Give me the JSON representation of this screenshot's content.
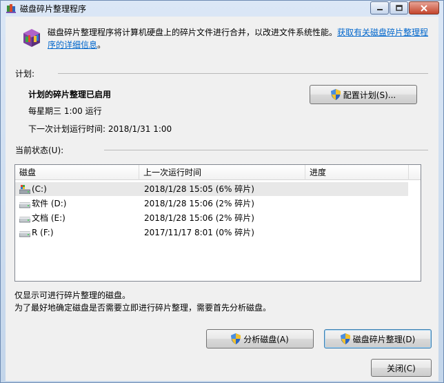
{
  "window": {
    "title": "磁盘碎片整理程序"
  },
  "intro": {
    "text": "磁盘碎片整理程序将计算机硬盘上的碎片文件进行合并，以改进文件系统性能。",
    "link": "获取有关磁盘碎片整理程序的详细信息",
    "tail": "。"
  },
  "schedule": {
    "group_label": "计划:",
    "status": "计划的碎片整理已启用",
    "frequency": "每星期三  1:00 运行",
    "next_run": "下一次计划运行时间: 2018/1/31 1:00",
    "configure_button": "配置计划(S)..."
  },
  "current_status": {
    "group_label": "当前状态(U):",
    "columns": [
      "磁盘",
      "上一次运行时间",
      "进度"
    ],
    "rows": [
      {
        "disk": "(C:)",
        "last_run": "2018/1/28 15:05 (6% 碎片)",
        "progress": "",
        "icon": "system-drive-icon"
      },
      {
        "disk": "软件 (D:)",
        "last_run": "2018/1/28 15:06 (2% 碎片)",
        "progress": "",
        "icon": "drive-icon"
      },
      {
        "disk": "文档 (E:)",
        "last_run": "2018/1/28 15:06 (2% 碎片)",
        "progress": "",
        "icon": "drive-icon"
      },
      {
        "disk": "R  (F:)",
        "last_run": "2017/11/17 8:01 (0% 碎片)",
        "progress": "",
        "icon": "drive-icon"
      }
    ]
  },
  "notes": {
    "line1": "仅显示可进行碎片整理的磁盘。",
    "line2": "为了最好地确定磁盘是否需要立即进行碎片整理，需要首先分析磁盘。"
  },
  "actions": {
    "analyze": "分析磁盘(A)",
    "defragment": "磁盘碎片整理(D)",
    "close": "关闭(C)"
  },
  "colors": {
    "link": "#0066cc",
    "title_bar": "#c9d9ec",
    "client_bg": "#f0f0f0",
    "close_button": "#c4452c"
  }
}
